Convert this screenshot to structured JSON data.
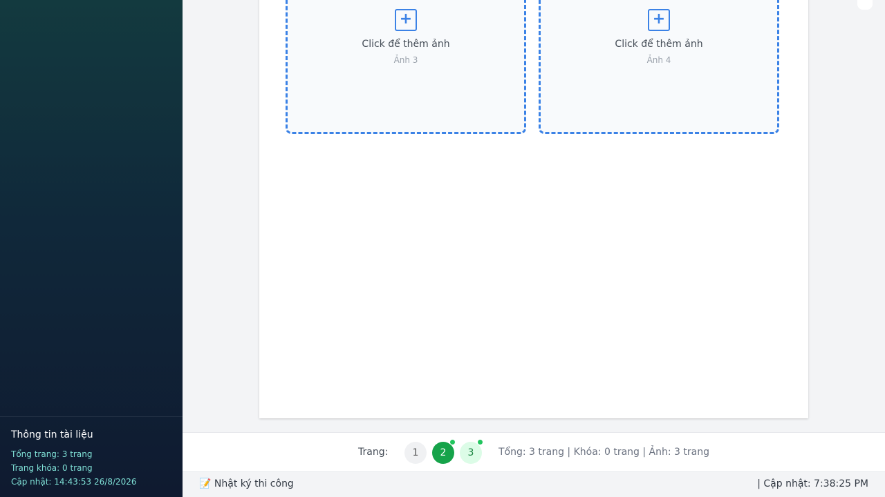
{
  "sidebar": {
    "doc_info": {
      "title": "Thông tin tài liệu",
      "total_pages": "Tổng trang: 3 trang",
      "locked_pages": "Trang khóa: 0 trang",
      "updated": "Cập nhật: 14:43:53 26/8/2026"
    }
  },
  "sheet": {
    "slots": [
      {
        "plus": "+",
        "label": "Click để thêm ảnh",
        "sub": "Ảnh 3"
      },
      {
        "plus": "+",
        "label": "Click để thêm ảnh",
        "sub": "Ảnh 4"
      }
    ]
  },
  "pager": {
    "label": "Trang:",
    "pages": [
      "1",
      "2",
      "3"
    ],
    "current": "2",
    "summary": "Tổng: 3 trang | Khóa: 0 trang | Ảnh: 3 trang"
  },
  "footer": {
    "left_icon": "📝",
    "left_label": "Nhật ký thi công",
    "right_label": "| Cập nhật: 7:38:25 PM"
  },
  "colors": {
    "accent": "#3b82e6",
    "active_page": "#16a34a",
    "status_dot": "#22c55e"
  }
}
